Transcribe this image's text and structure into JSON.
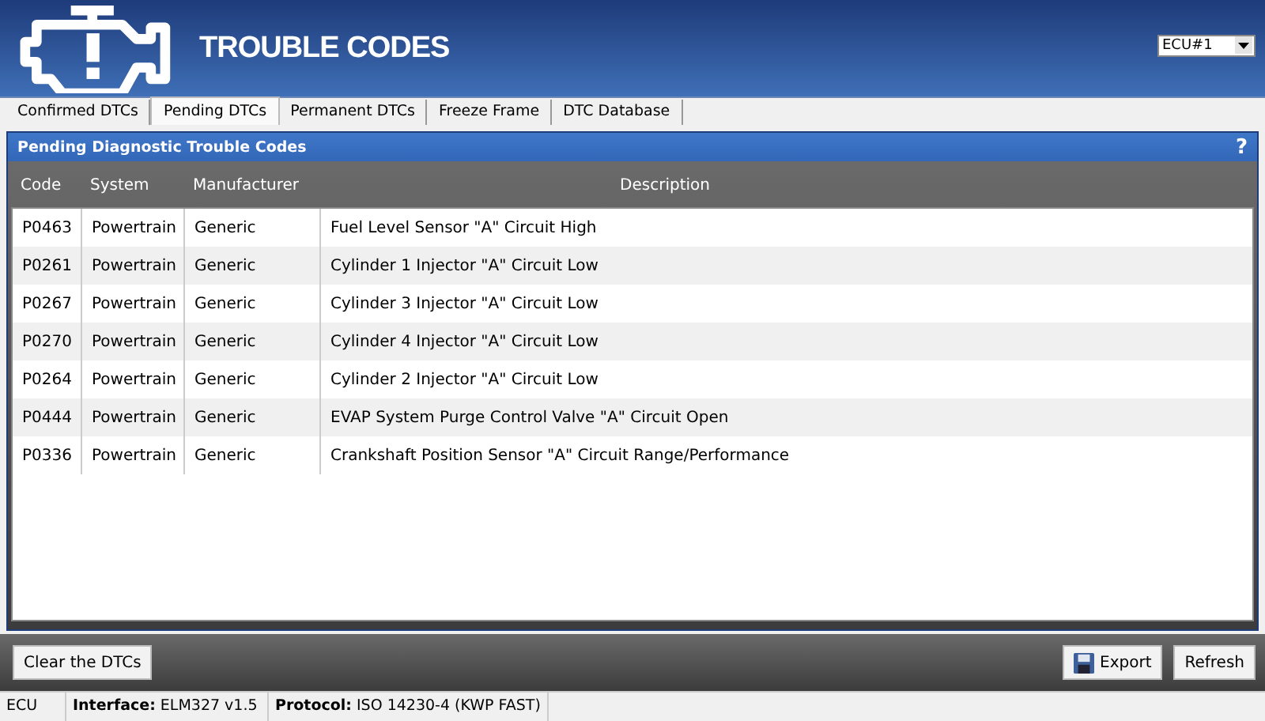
{
  "header": {
    "title": "TROUBLE CODES",
    "ecu_select": {
      "value": "ECU#1"
    }
  },
  "tabs": [
    {
      "label": "Confirmed DTCs",
      "selected": false
    },
    {
      "label": "Pending DTCs",
      "selected": true
    },
    {
      "label": "Permanent DTCs",
      "selected": false
    },
    {
      "label": "Freeze Frame",
      "selected": false
    },
    {
      "label": "DTC Database",
      "selected": false
    }
  ],
  "panel": {
    "title": "Pending Diagnostic Trouble Codes",
    "help": "?"
  },
  "table": {
    "columns": [
      "Code",
      "System",
      "Manufacturer",
      "Description"
    ],
    "rows": [
      [
        "P0463",
        "Powertrain",
        "Generic",
        "Fuel Level Sensor \"A\" Circuit High"
      ],
      [
        "P0261",
        "Powertrain",
        "Generic",
        "Cylinder 1 Injector \"A\" Circuit Low"
      ],
      [
        "P0267",
        "Powertrain",
        "Generic",
        "Cylinder 3 Injector \"A\" Circuit Low"
      ],
      [
        "P0270",
        "Powertrain",
        "Generic",
        "Cylinder 4 Injector \"A\" Circuit Low"
      ],
      [
        "P0264",
        "Powertrain",
        "Generic",
        "Cylinder 2 Injector \"A\" Circuit Low"
      ],
      [
        "P0444",
        "Powertrain",
        "Generic",
        "EVAP System Purge Control Valve \"A\" Circuit Open"
      ],
      [
        "P0336",
        "Powertrain",
        "Generic",
        "Crankshaft Position Sensor \"A\" Circuit Range/Performance"
      ]
    ]
  },
  "buttons": {
    "left": "Clear the DTCs",
    "export": "Export",
    "refresh": "Refresh"
  },
  "status_bar": [
    "ECU",
    "**Interface:** ELM327 v1.5",
    "**Protocol:** ISO 14230-4 (KWP FAST)"
  ]
}
